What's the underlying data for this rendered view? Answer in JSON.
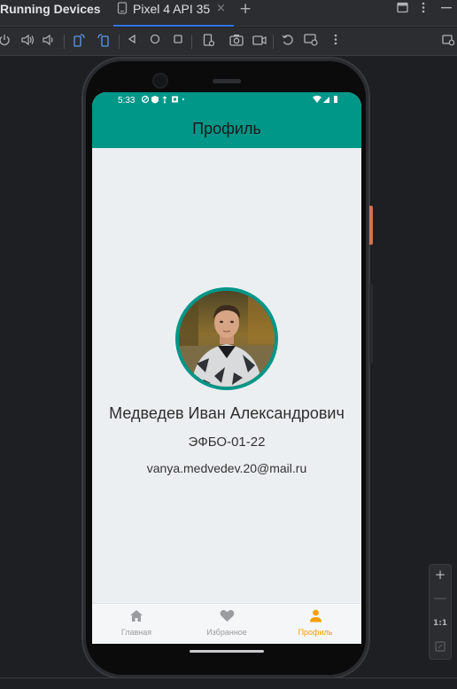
{
  "ide": {
    "panel_title": "Running Devices",
    "device_tab_label": "Pixel 4 API 35",
    "tab_close_glyph": "×",
    "add_tab_glyph": "+"
  },
  "toolbar_icons": [
    "power-icon",
    "volume-up-icon",
    "volume-down-icon",
    "rotate-left-icon",
    "rotate-right-icon",
    "back-icon",
    "home-icon",
    "overview-icon",
    "screenshot-icon",
    "camera-icon",
    "screen-record-icon",
    "reset-icon",
    "snapshot-icon",
    "more-icon"
  ],
  "phone": {
    "status_bar": {
      "time": "5:33"
    },
    "app_bar": {
      "title": "Профиль"
    },
    "profile": {
      "name": "Медведев Иван Александрович",
      "group": "ЭФБО-01-22",
      "email": "vanya.medvedev.20@mail.ru"
    },
    "bottom_nav": [
      {
        "label": "Главная",
        "icon": "home-icon",
        "active": false
      },
      {
        "label": "Избранное",
        "icon": "heart-icon",
        "active": false
      },
      {
        "label": "Профиль",
        "icon": "person-icon",
        "active": true
      }
    ]
  },
  "zoom_panel": {
    "zoom_in": "+",
    "zoom_out": "—",
    "actual_size": "1:1"
  },
  "colors": {
    "primary": "#009688",
    "accent": "#f59e0b",
    "screen_bg": "#eceff1",
    "ide_bg": "#2b2d30"
  }
}
